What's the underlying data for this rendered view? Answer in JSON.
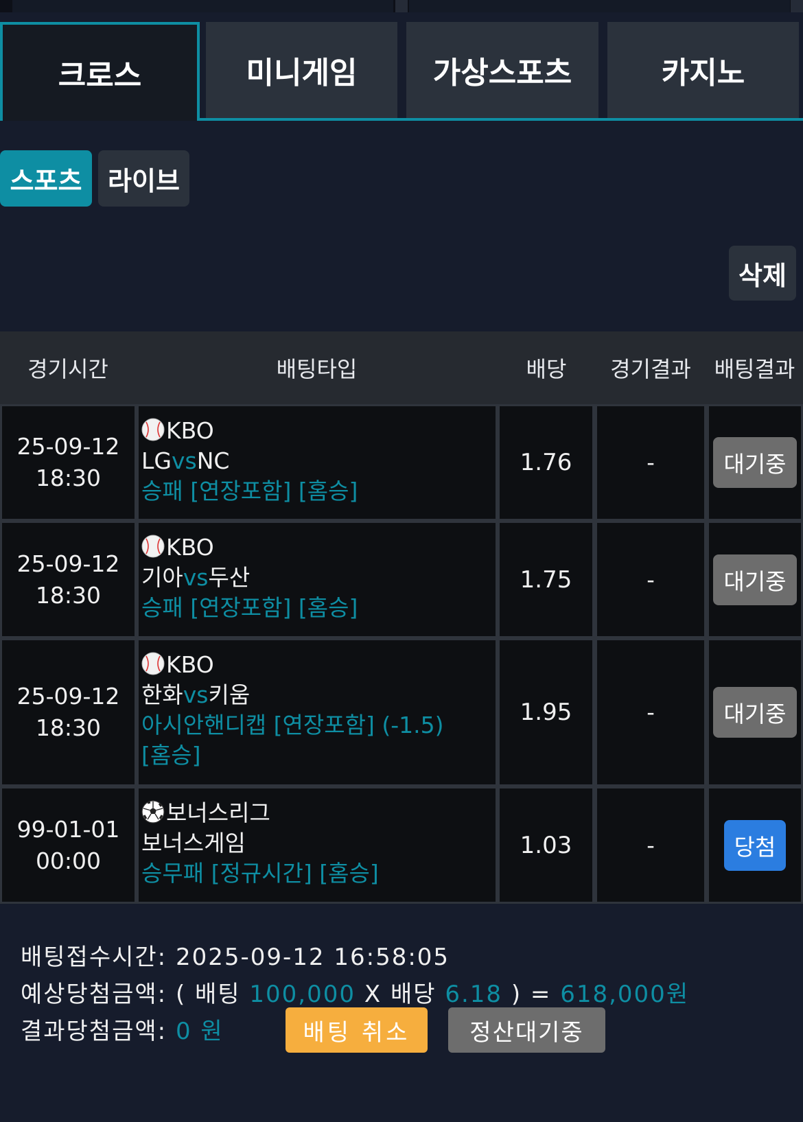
{
  "tabs": [
    {
      "label": "크로스",
      "active": true
    },
    {
      "label": "미니게임",
      "active": false
    },
    {
      "label": "가상스포츠",
      "active": false
    },
    {
      "label": "카지노",
      "active": false
    }
  ],
  "subtabs": [
    {
      "label": "스포츠",
      "active": true
    },
    {
      "label": "라이브",
      "active": false
    }
  ],
  "delete_label": "삭제",
  "table": {
    "headers": {
      "time": "경기시간",
      "bet_type": "배팅타입",
      "odds": "배당",
      "game_result": "경기결과",
      "bet_result": "배팅결과"
    },
    "rows": [
      {
        "date": "25-09-12",
        "time": "18:30",
        "sport_icon": "baseball-icon",
        "league": "KBO",
        "home": "LG",
        "vs": "vs",
        "away": "NC",
        "bet_type": "승패 [연장포함] [홈승]",
        "odds": "1.76",
        "game_result": "-",
        "bet_result": "대기중",
        "status": "pending"
      },
      {
        "date": "25-09-12",
        "time": "18:30",
        "sport_icon": "baseball-icon",
        "league": "KBO",
        "home": "기아",
        "vs": "vs",
        "away": "두산",
        "bet_type": "승패 [연장포함] [홈승]",
        "odds": "1.75",
        "game_result": "-",
        "bet_result": "대기중",
        "status": "pending"
      },
      {
        "date": "25-09-12",
        "time": "18:30",
        "sport_icon": "baseball-icon",
        "league": "KBO",
        "home": "한화",
        "vs": "vs",
        "away": "키움",
        "bet_type": "아시안핸디캡 [연장포함] (-1.5)",
        "bet_type_line2": "[홈승]",
        "odds": "1.95",
        "game_result": "-",
        "bet_result": "대기중",
        "status": "pending"
      },
      {
        "date": "99-01-01",
        "time": "00:00",
        "sport_icon": "soccer-ball-icon",
        "league": "보너스리그",
        "match": "보너스게임",
        "bet_type": "승무패 [정규시간] [홈승]",
        "odds": "1.03",
        "game_result": "-",
        "bet_result": "당첨",
        "status": "won"
      }
    ]
  },
  "summary": {
    "accept_time_label": "배팅접수시간:",
    "accept_time": "2025-09-12 16:58:05",
    "expected_label": "예상당첨금액:",
    "open_paren": "(",
    "bet_label": "배팅",
    "bet_amount": "100,000",
    "times": "X",
    "odds_label": "배당",
    "total_odds": "6.18",
    "close_paren": ")",
    "equals": "=",
    "expected_amount": "618,000원",
    "result_label": "결과당첨금액:",
    "result_amount": "0",
    "result_unit": "원",
    "cancel_label": "배팅 취소",
    "settle_label": "정산대기중"
  },
  "colors": {
    "accent": "#0e8ea3",
    "pending": "#6d6d6d",
    "won": "#2b7de0",
    "cancel": "#f6ae3e",
    "background": "#161c2c"
  }
}
